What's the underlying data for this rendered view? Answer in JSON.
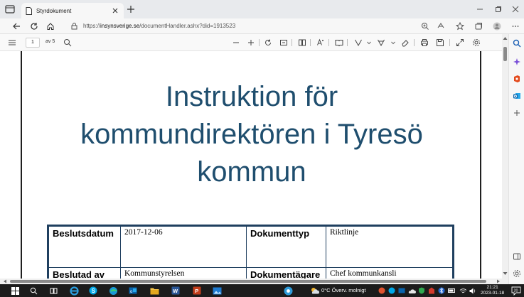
{
  "browser": {
    "tab_title": "Styrdokument",
    "url_prefix": "https://",
    "url_host": "insynsverige.se",
    "url_path": "/documentHandler.ashx?did=1913523"
  },
  "pdf_toolbar": {
    "page_number": "1",
    "page_total": "av 5"
  },
  "document": {
    "title_line1": "Instruktion för",
    "title_line2": "kommundirektören i Tyresö",
    "title_line3": "kommun",
    "table": {
      "row1": {
        "label1": "Beslutsdatum",
        "value1": "2017-12-06",
        "label2": "Dokumenttyp",
        "value2": "Riktlinje"
      },
      "row2": {
        "label1": "Beslutad av",
        "value1": "Kommunstyrelsen",
        "label2": "Dokumentägare",
        "value2": "Chef kommunkansli"
      }
    }
  },
  "taskbar": {
    "weather": "0°C  Överv. molnigt",
    "time": "21:21",
    "date": "2023-01-18",
    "notifications": "20"
  },
  "colors": {
    "title_blue": "#1f4e6e",
    "table_border": "#1f3f5f",
    "taskbar": "#1c1c1c"
  }
}
